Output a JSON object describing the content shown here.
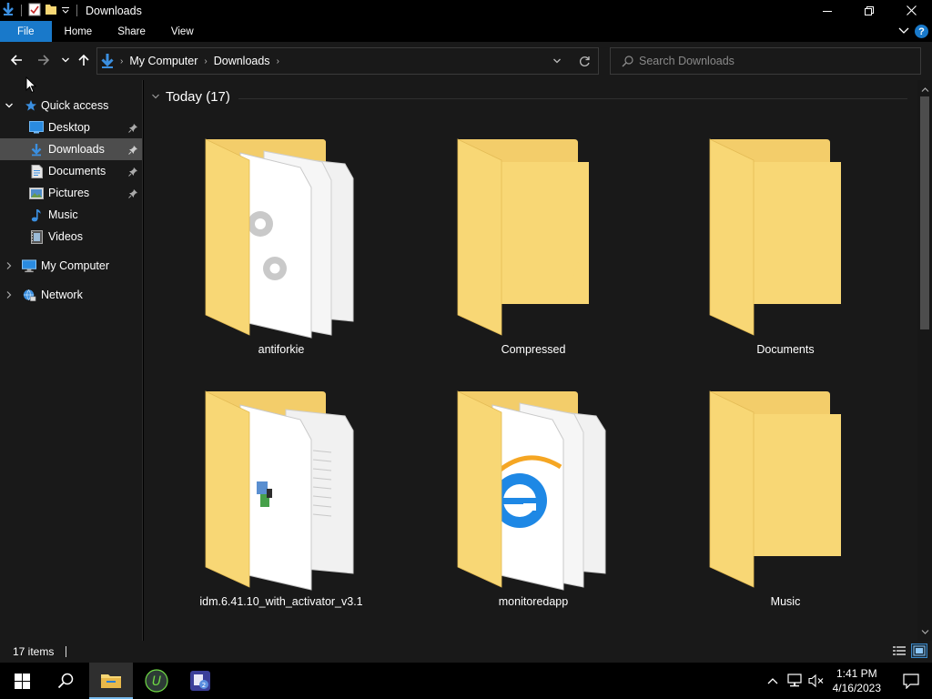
{
  "window": {
    "title": "Downloads"
  },
  "ribbon": {
    "tabs": [
      {
        "label": "File"
      },
      {
        "label": "Home"
      },
      {
        "label": "Share"
      },
      {
        "label": "View"
      }
    ],
    "help": "?"
  },
  "address": {
    "breadcrumb": [
      {
        "label": "My Computer"
      },
      {
        "label": "Downloads"
      }
    ]
  },
  "search": {
    "placeholder": "Search Downloads",
    "value": ""
  },
  "nav": {
    "items": [
      {
        "label": "Quick access",
        "icon": "star-icon",
        "expanded": true
      },
      {
        "label": "Desktop",
        "icon": "desktop-icon",
        "pinned": true
      },
      {
        "label": "Downloads",
        "icon": "download-icon",
        "pinned": true,
        "selected": true
      },
      {
        "label": "Documents",
        "icon": "documents-icon",
        "pinned": true
      },
      {
        "label": "Pictures",
        "icon": "pictures-icon",
        "pinned": true
      },
      {
        "label": "Music",
        "icon": "music-icon"
      },
      {
        "label": "Videos",
        "icon": "videos-icon"
      },
      {
        "label": "My Computer",
        "icon": "computer-icon",
        "expanded": false
      },
      {
        "label": "Network",
        "icon": "network-icon",
        "expanded": false
      }
    ]
  },
  "content": {
    "group": {
      "label": "Today (17)"
    },
    "items": [
      {
        "name": "antiforkie",
        "type": "folder-with-files",
        "preview": "gears"
      },
      {
        "name": "Compressed",
        "type": "folder-empty"
      },
      {
        "name": "Documents",
        "type": "folder-empty"
      },
      {
        "name": "idm.6.41.10_with_activator_v3.1",
        "type": "folder-with-files",
        "preview": "installer"
      },
      {
        "name": "monitoredapp",
        "type": "folder-with-files",
        "preview": "internet-explorer"
      },
      {
        "name": "Music",
        "type": "folder-empty"
      }
    ]
  },
  "status": {
    "count": "17 items"
  },
  "taskbar": {
    "apps": [
      "start-icon",
      "search-icon",
      "file-explorer-icon",
      "upwork-icon",
      "app-icon"
    ]
  },
  "clock": {
    "time": "1:41 PM",
    "date": "4/16/2023"
  },
  "colors": {
    "accent": "#1979ca",
    "folder": "#f8d775",
    "folder_dark": "#e8b84a",
    "background": "#191919"
  }
}
